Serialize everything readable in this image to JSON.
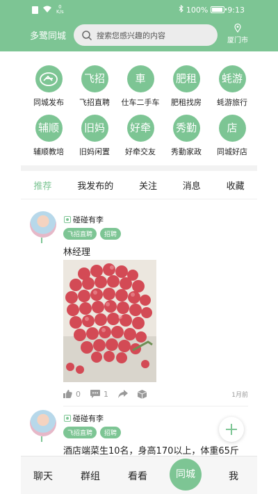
{
  "status_bar": {
    "speed_value": "0",
    "speed_unit": "K/s",
    "battery_percent": "100%",
    "battery_level": 1.0,
    "time": "9:13"
  },
  "header": {
    "title": "多鹭同城",
    "search_placeholder": "搜索您感兴趣的内容",
    "city": "厦门市"
  },
  "categories": [
    {
      "icon": "同城发布",
      "glyph": "⌂",
      "label": "同城发布"
    },
    {
      "icon": "飞招",
      "glyph": "飞招",
      "label": "飞招直聘"
    },
    {
      "icon": "仕车",
      "glyph": "車",
      "label": "仕车二手车"
    },
    {
      "icon": "肥租",
      "glyph": "肥租",
      "label": "肥租找房"
    },
    {
      "icon": "蚝游",
      "glyph": "蚝游",
      "label": "蚝游旅行"
    },
    {
      "icon": "辅顺",
      "glyph": "辅顺",
      "label": "辅顺教培"
    },
    {
      "icon": "旧妈",
      "glyph": "旧妈",
      "label": "旧妈闲置"
    },
    {
      "icon": "好牵",
      "glyph": "好牵",
      "label": "好牵交友"
    },
    {
      "icon": "秀勤",
      "glyph": "秀勤",
      "label": "秀勤家政"
    },
    {
      "icon": "店",
      "glyph": "店",
      "label": "同城好店"
    }
  ],
  "tabs": [
    {
      "label": "推荐",
      "active": true
    },
    {
      "label": "我发布的",
      "active": false
    },
    {
      "label": "关注",
      "active": false
    },
    {
      "label": "消息",
      "active": false
    },
    {
      "label": "收藏",
      "active": false
    }
  ],
  "posts": [
    {
      "user": "碰碰有李",
      "tags": [
        "飞招直聘",
        "招聘"
      ],
      "text": "林经理",
      "image": "lychee-photo",
      "likes": "0",
      "comments": "1",
      "time": "1月前"
    },
    {
      "user": "碰碰有李",
      "tags": [
        "飞招直聘",
        "招聘"
      ],
      "text": "酒店端菜生10名，身高170以上，体重65斤"
    }
  ],
  "bottom_nav": {
    "items": [
      "聊天",
      "群组",
      "看看",
      "同城",
      "我"
    ],
    "active": "同城"
  },
  "colors": {
    "brand": "#7dc594",
    "background": "#ffffff",
    "tag_text": "#ffffff"
  }
}
